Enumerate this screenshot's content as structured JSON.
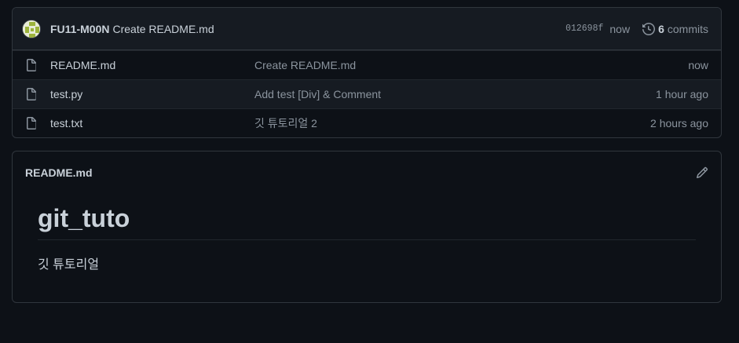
{
  "latest_commit": {
    "author": "FU11-M00N",
    "message": "Create README.md",
    "sha": "012698f",
    "time": "now",
    "commit_count": "6",
    "commits_label": "commits"
  },
  "files": [
    {
      "name": "README.md",
      "message": "Create README.md",
      "time": "now"
    },
    {
      "name": "test.py",
      "message": "Add test [Div] & Comment",
      "time": "1 hour ago"
    },
    {
      "name": "test.txt",
      "message": "깃 튜토리얼 2",
      "time": "2 hours ago"
    }
  ],
  "readme": {
    "filename": "README.md",
    "heading": "git_tuto",
    "paragraph": "깃 튜토리얼"
  },
  "icons": {
    "history": "history-icon",
    "file": "file-icon",
    "edit": "pencil-icon"
  },
  "colors": {
    "background": "#0d1117",
    "header_bg": "#161b22",
    "border": "#30363d",
    "text": "#c9d1d9",
    "muted": "#8b949e"
  }
}
